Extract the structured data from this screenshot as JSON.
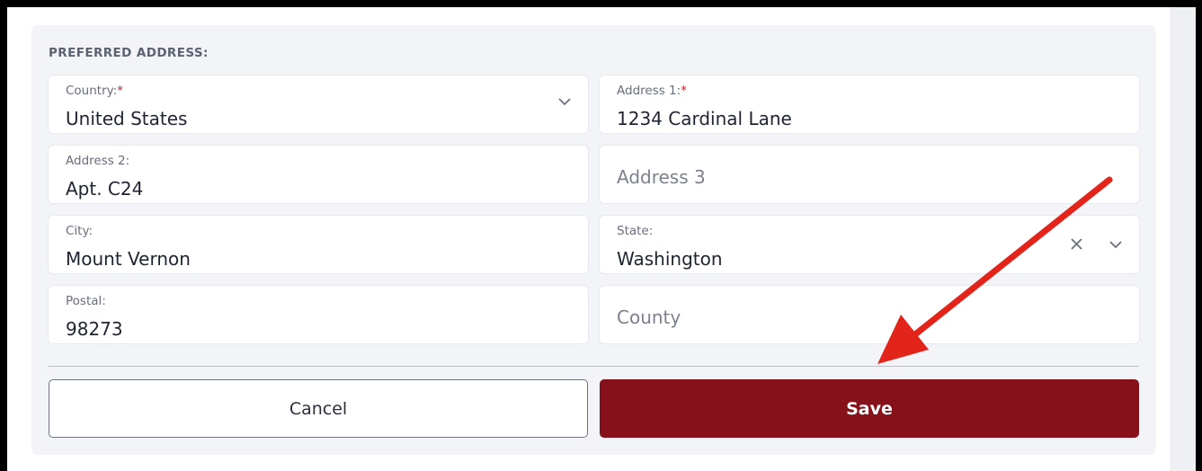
{
  "section": {
    "title": "PREFERRED ADDRESS:"
  },
  "fields": {
    "country": {
      "label": "Country:",
      "required": "*",
      "value": "United States"
    },
    "address1": {
      "label": "Address 1:",
      "required": "*",
      "value": "1234 Cardinal Lane"
    },
    "address2": {
      "label": "Address 2:",
      "value": "Apt. C24"
    },
    "address3": {
      "placeholder": "Address 3"
    },
    "city": {
      "label": "City:",
      "value": "Mount Vernon"
    },
    "state": {
      "label": "State:",
      "value": "Washington"
    },
    "postal": {
      "label": "Postal:",
      "value": "98273"
    },
    "county": {
      "placeholder": "County"
    }
  },
  "buttons": {
    "cancel": "Cancel",
    "save": "Save"
  },
  "icons": {
    "dropdown": "chevron-down-icon",
    "clear": "close-icon",
    "annotation": "red-arrow-icon"
  },
  "colors": {
    "accent": "#86111b",
    "required": "#c0262f",
    "annotation_arrow": "#e3241b"
  }
}
